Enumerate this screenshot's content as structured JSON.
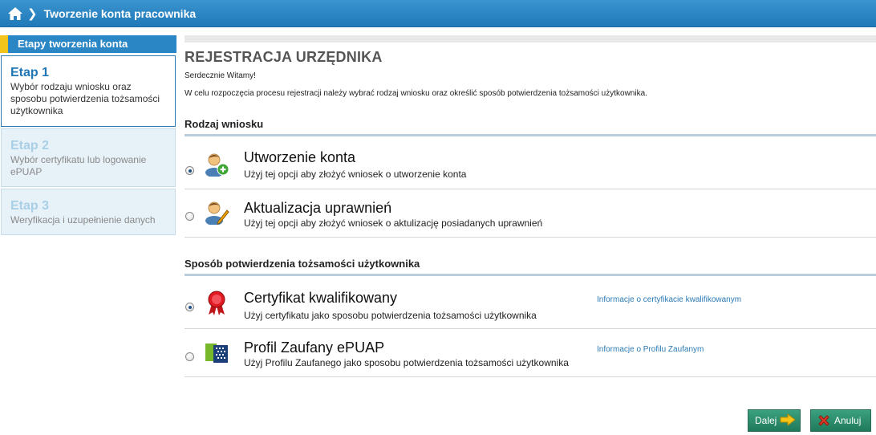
{
  "header": {
    "title": "Tworzenie konta pracownika"
  },
  "sidebar": {
    "title": "Etapy tworzenia konta",
    "steps": [
      {
        "title": "Etap 1",
        "desc": "Wybór rodzaju wniosku oraz sposobu potwierdzenia tożsamości użytkownika"
      },
      {
        "title": "Etap 2",
        "desc": "Wybór certyfikatu lub logowanie ePUAP"
      },
      {
        "title": "Etap 3",
        "desc": "Weryfikacja i uzupełnienie danych"
      }
    ]
  },
  "main": {
    "title": "REJESTRACJA URZĘDNIKA",
    "welcome": "Serdecznie Witamy!",
    "intro": "W celu rozpoczęcia procesu rejestracji należy wybrać rodzaj wniosku oraz określić sposób potwierdzenia tożsamości użytkownika.",
    "request_section": {
      "title": "Rodzaj wniosku",
      "options": [
        {
          "title": "Utworzenie konta",
          "desc": "Użyj tej opcji aby złożyć wniosek o utworzenie konta",
          "icon": "user-add-icon",
          "selected": true
        },
        {
          "title": "Aktualizacja uprawnień",
          "desc": "Użyj tej opcji aby złożyć wniosek o aktulizację posiadanych uprawnień",
          "icon": "user-edit-icon",
          "selected": false
        }
      ]
    },
    "identity_section": {
      "title": "Sposób potwierdzenia tożsamości użytkownika",
      "options": [
        {
          "title": "Certyfikat kwalifikowany",
          "desc": "Użyj certyfikatu jako sposobu potwierdzenia tożsamości użytkownika",
          "link": "Informacje o certyfikacie kwalifikowanym",
          "icon": "certificate-ribbon-icon",
          "selected": true
        },
        {
          "title": "Profil Zaufany ePUAP",
          "desc": "Użyj Profilu Zaufanego jako sposobu potwierdzenia tożsamości użytkownika",
          "link": "Informacje o Profilu Zaufanym",
          "icon": "epuap-logo-icon",
          "selected": false
        }
      ]
    }
  },
  "buttons": {
    "next": "Dalej",
    "cancel": "Anuluj"
  },
  "colors": {
    "header": "#2b86c5",
    "accent_yellow": "#f2c318",
    "button_green": "#1f7a5b",
    "link": "#2b7ab3"
  }
}
